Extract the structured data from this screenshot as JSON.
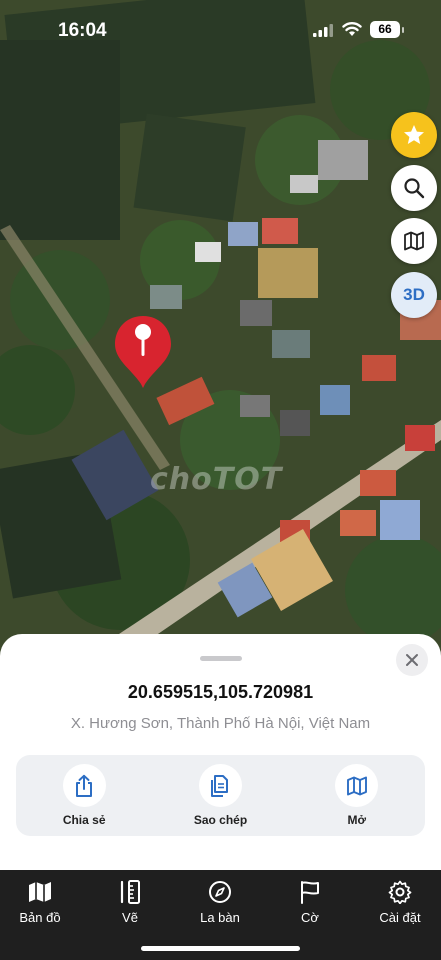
{
  "status_bar": {
    "time": "16:04",
    "battery": "66"
  },
  "map": {
    "watermark": "choTOT"
  },
  "map_controls": {
    "three_d_label": "3D"
  },
  "location": {
    "coordinates": "20.659515,105.720981",
    "address": "X. Hương Sơn, Thành Phố Hà Nội, Việt Nam"
  },
  "actions": [
    {
      "label": "Chia sẻ",
      "icon": "share-icon"
    },
    {
      "label": "Sao chép",
      "icon": "copy-icon"
    },
    {
      "label": "Mở",
      "icon": "map-icon"
    }
  ],
  "tabs": [
    {
      "label": "Bản đồ",
      "icon": "map-icon"
    },
    {
      "label": "Vẽ",
      "icon": "ruler-icon"
    },
    {
      "label": "La bàn",
      "icon": "compass-icon"
    },
    {
      "label": "Cờ",
      "icon": "flag-icon"
    },
    {
      "label": "Cài đặt",
      "icon": "gear-icon"
    }
  ],
  "colors": {
    "accent": "#2d6ec4",
    "star_button": "#f6c21c",
    "pin": "#d8242f",
    "tab_bar": "#1f1f1f"
  }
}
